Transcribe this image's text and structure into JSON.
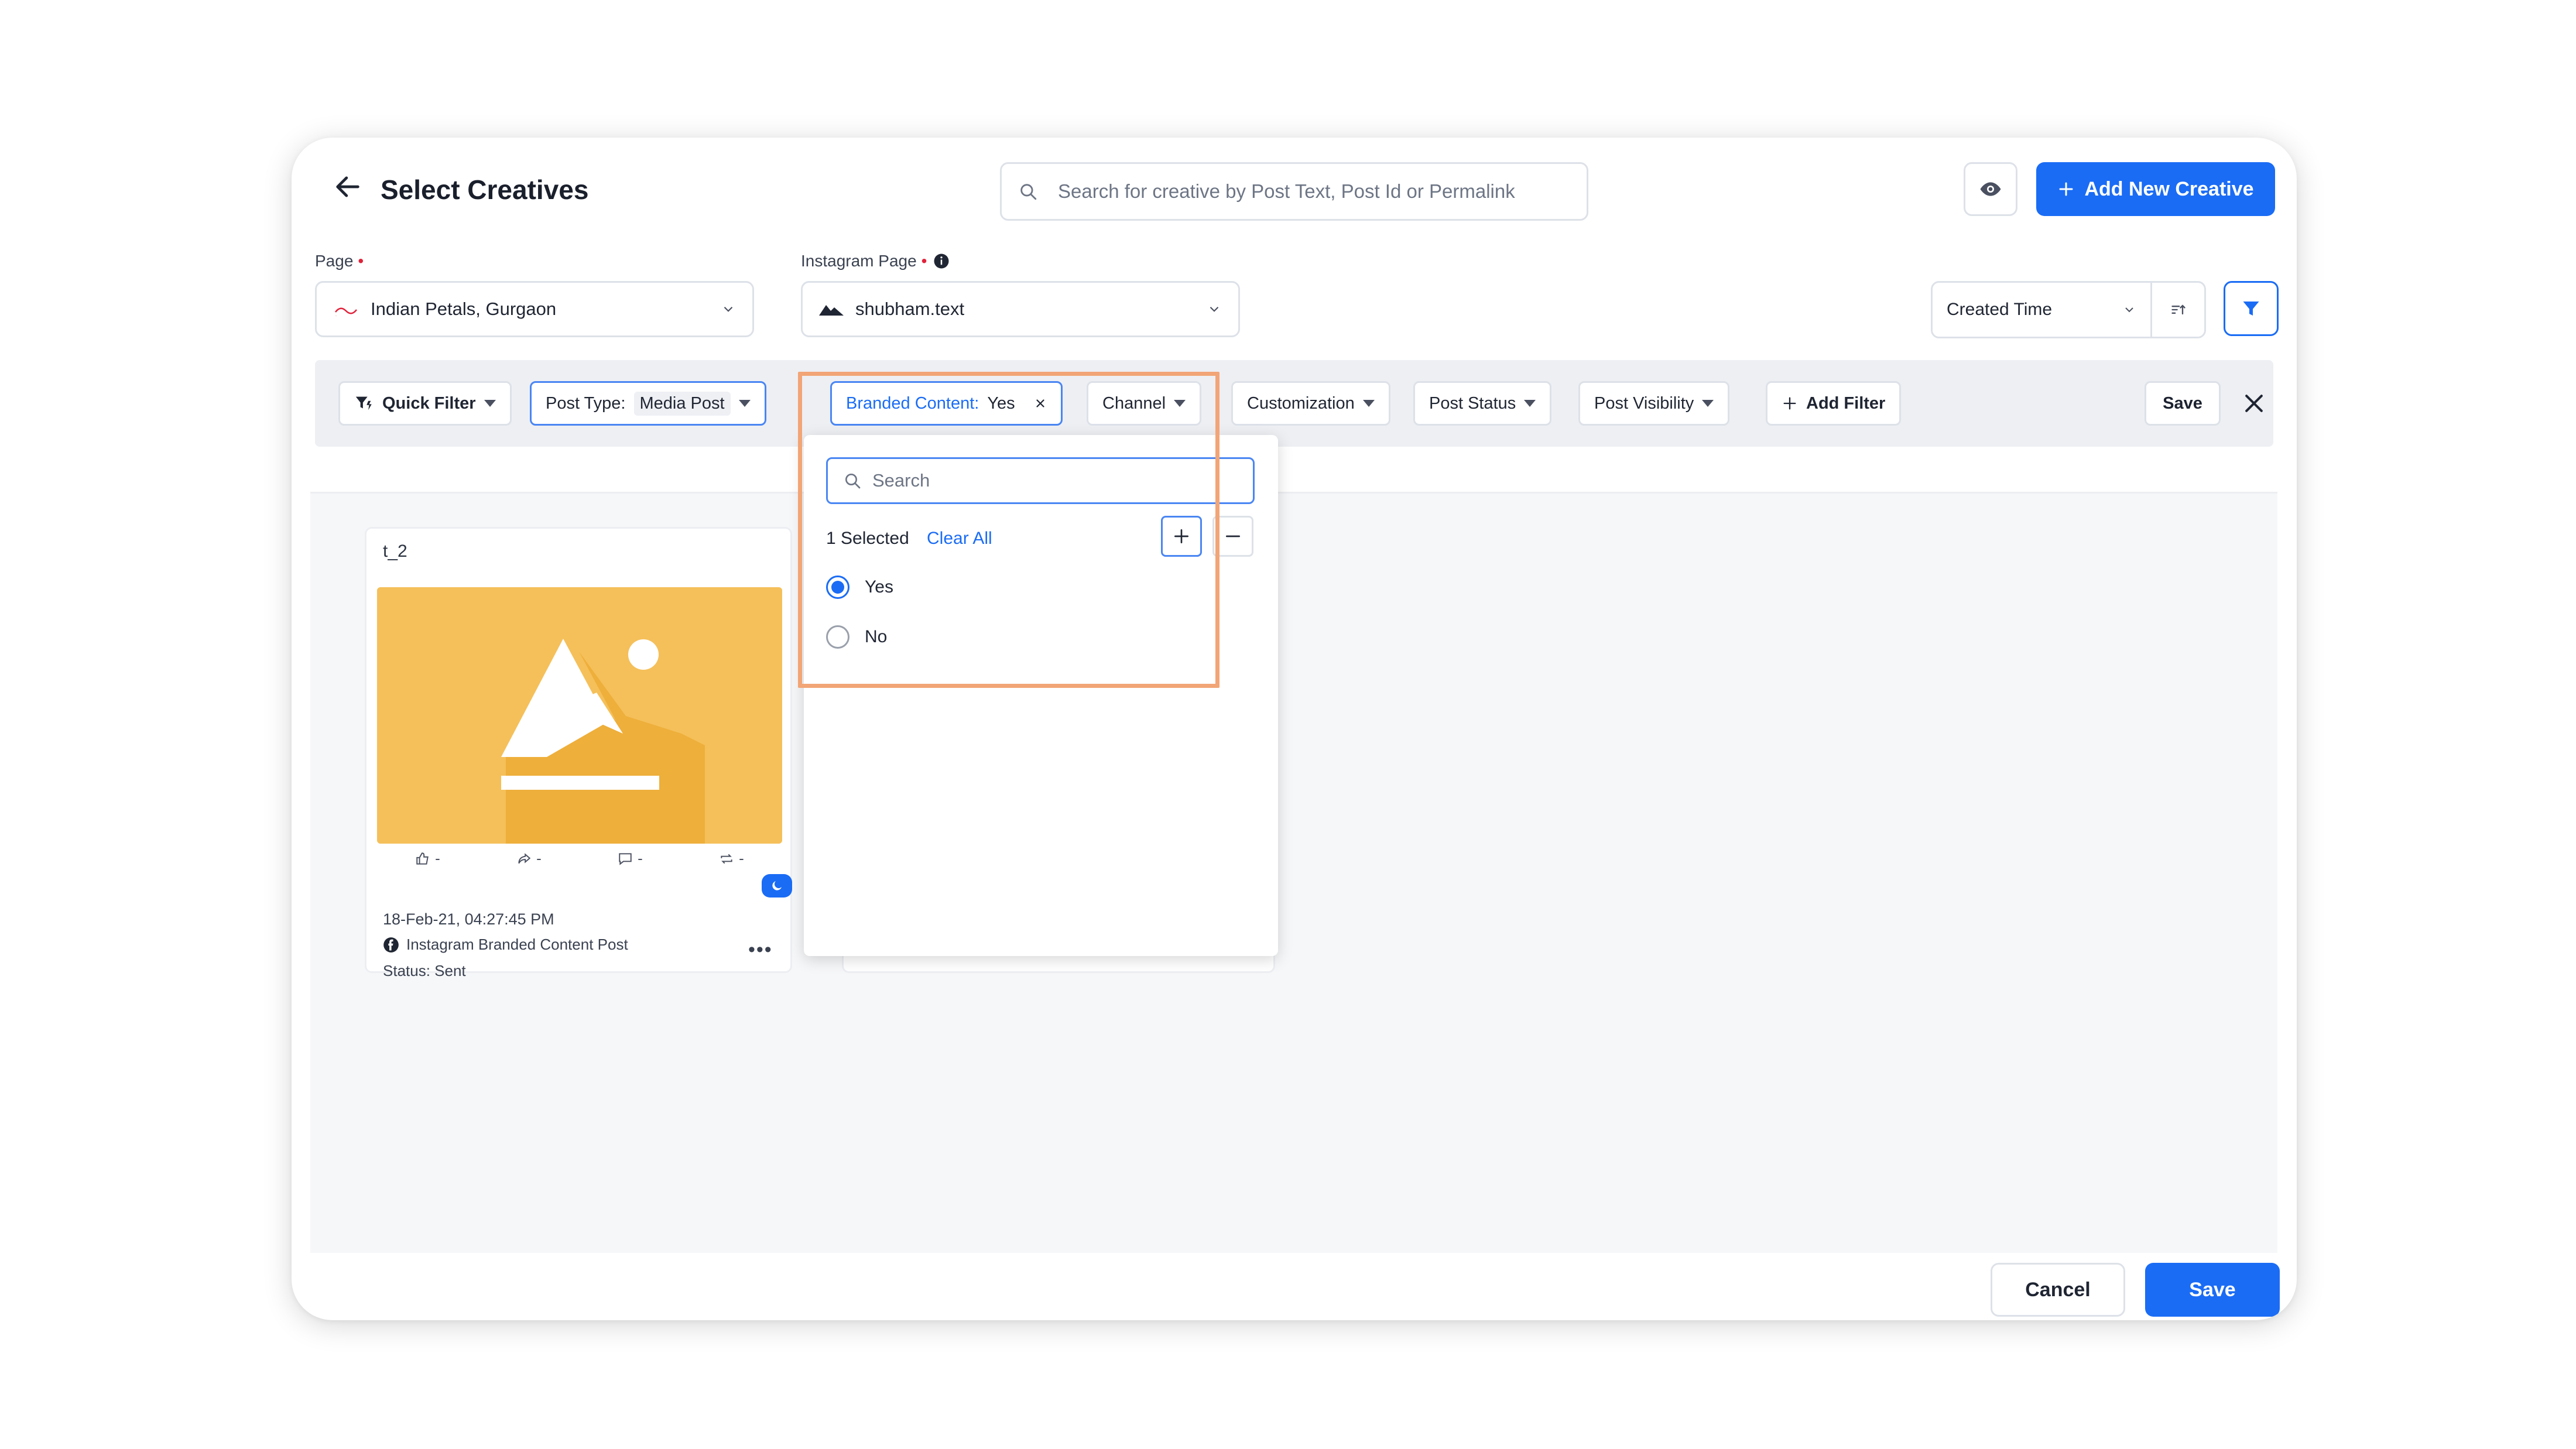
{
  "header": {
    "title": "Select Creatives",
    "search_placeholder": "Search for creative by Post Text, Post Id or Permalink",
    "add_new_label": "Add New Creative"
  },
  "selectors": {
    "page_label": "Page",
    "page_value": "Indian Petals, Gurgaon",
    "instagram_label": "Instagram Page",
    "instagram_value": "shubham.text",
    "sort_value": "Created Time"
  },
  "filter_bar": {
    "quick_filter": "Quick Filter",
    "post_type_label": "Post Type:",
    "post_type_value": "Media Post",
    "branded_label": "Branded Content:",
    "branded_value": "Yes",
    "channel": "Channel",
    "customization": "Customization",
    "post_status": "Post Status",
    "post_visibility": "Post Visibility",
    "add_filter": "Add Filter",
    "save": "Save"
  },
  "dropdown": {
    "search_placeholder": "Search",
    "selected_text": "1 Selected",
    "clear_all": "Clear All",
    "options": [
      {
        "label": "Yes",
        "selected": true
      },
      {
        "label": "No",
        "selected": false
      }
    ]
  },
  "card": {
    "name": "t_2",
    "likes": "-",
    "shares": "-",
    "comments": "-",
    "reposts": "-",
    "date": "18-Feb-21, 04:27:45 PM",
    "type": "Instagram Branded Content Post",
    "status": "Status: Sent"
  },
  "footer": {
    "cancel": "Cancel",
    "save": "Save"
  },
  "colors": {
    "primary": "#1a6cf5",
    "highlight": "#f2a576",
    "thumbnail": "#f5c05a"
  }
}
